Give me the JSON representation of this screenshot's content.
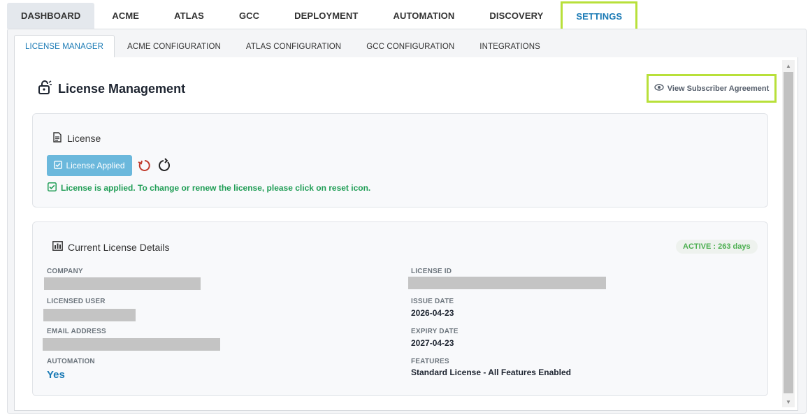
{
  "top_tabs": [
    "DASHBOARD",
    "ACME",
    "ATLAS",
    "GCC",
    "DEPLOYMENT",
    "AUTOMATION",
    "DISCOVERY",
    "SETTINGS"
  ],
  "sub_tabs": [
    "LICENSE MANAGER",
    "ACME CONFIGURATION",
    "ATLAS CONFIGURATION",
    "GCC CONFIGURATION",
    "INTEGRATIONS"
  ],
  "page": {
    "title": "License Management",
    "agreement_link": "View Subscriber Agreement"
  },
  "license_card": {
    "title": "License",
    "applied_button": "License Applied",
    "message": "License is applied. To change or renew the license, please click on reset icon."
  },
  "details_card": {
    "title": "Current License Details",
    "status": "ACTIVE : 263 days",
    "fields": {
      "company_label": "COMPANY",
      "licensed_user_label": "LICENSED USER",
      "email_label": "EMAIL ADDRESS",
      "automation_label": "AUTOMATION",
      "automation_value": "Yes",
      "license_id_label": "LICENSE ID",
      "issue_date_label": "ISSUE DATE",
      "issue_date_value": "2026-04-23",
      "expiry_date_label": "EXPIRY DATE",
      "expiry_date_value": "2027-04-23",
      "features_label": "FEATURES",
      "features_value": "Standard License - All Features Enabled"
    }
  },
  "colors": {
    "accent": "#1a7ab5",
    "highlight": "#b8e03a",
    "success": "#1f9d55",
    "applied_button": "#6bb8dc",
    "reset_icon": "#c0392b"
  }
}
